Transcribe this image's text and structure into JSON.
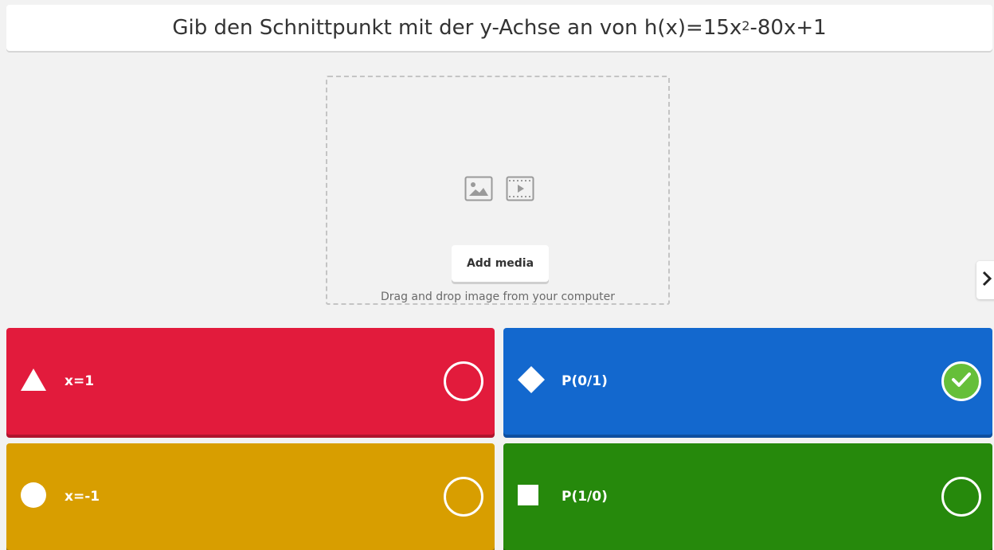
{
  "question": {
    "prefix": "Gib den Schnittpunkt mit der y-Achse an von h(x)=15x",
    "superscript": "2",
    "suffix": "-80x+1"
  },
  "media": {
    "image_icon": "image-icon",
    "video_icon": "video-icon",
    "add_button_label": "Add media",
    "drop_hint": "Drag and drop image from your computer"
  },
  "navigation": {
    "next_icon": "chevron-right-icon"
  },
  "answers": [
    {
      "shape": "triangle-icon",
      "label": "x=1",
      "color": "#e21b3c",
      "correct": false
    },
    {
      "shape": "diamond-icon",
      "label": "P(0/1)",
      "color": "#1368ce",
      "correct": true
    },
    {
      "shape": "circle-icon",
      "label": "x=-1",
      "color": "#d89e00",
      "correct": false
    },
    {
      "shape": "square-icon",
      "label": "P(1/0)",
      "color": "#26890c",
      "correct": false
    }
  ]
}
